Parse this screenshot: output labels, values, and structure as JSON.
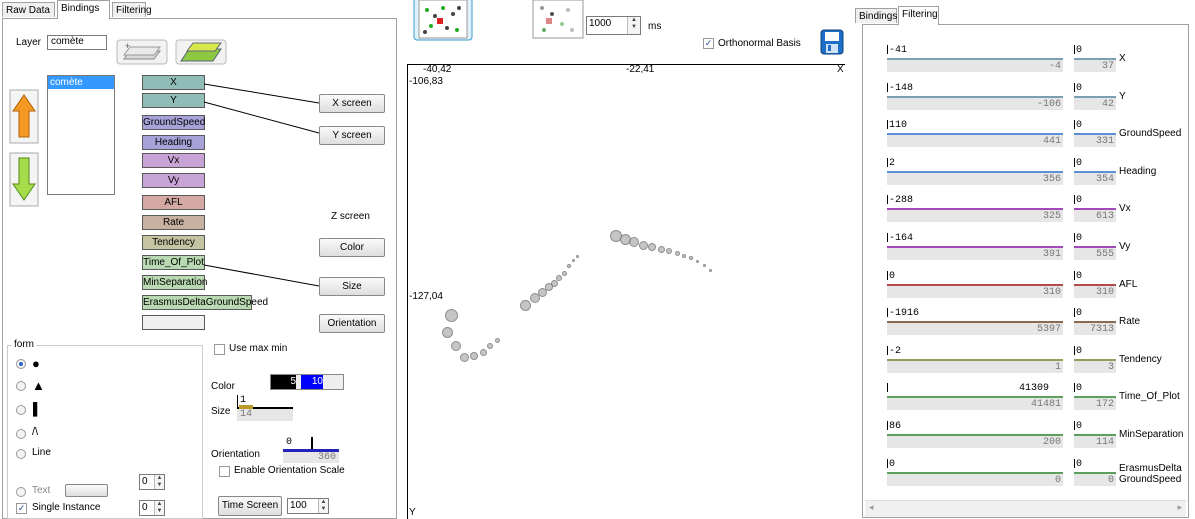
{
  "left_tabs": [
    "Raw Data",
    "Bindings",
    "Filtering"
  ],
  "layer": {
    "label": "Layer",
    "value": "comète",
    "list_items": [
      "comète"
    ]
  },
  "fields": [
    "X",
    "Y",
    "GroundSpeed",
    "Heading",
    "Vx",
    "Vy",
    "AFL",
    "Rate",
    "Tendency",
    "Time_Of_Plot",
    "MinSeparation",
    "ErasmusDeltaGroundSpeed",
    ""
  ],
  "field_colors": [
    "#8fbcb6",
    "#8fbcb6",
    "#a7a3d8",
    "#a7a3d8",
    "#c8a4d6",
    "#c8a4d6",
    "#d4a9a4",
    "#c8b1a0",
    "#c4c3a2",
    "#b9d9b2",
    "#b9d9b2",
    "#b9d9b2",
    "#f0f0f0"
  ],
  "screen_buttons": {
    "x": "X screen",
    "y": "Y screen",
    "z_label": "Z screen",
    "color": "Color",
    "size": "Size",
    "orientation": "Orientation"
  },
  "form": {
    "legend": "form",
    "options": [
      "●",
      "▲",
      "▌",
      "/\\",
      "Line"
    ],
    "text_label": "Text",
    "single_instance": "Single Instance",
    "text_spin": "0",
    "single_spin": "0"
  },
  "use_max_min": "Use max min",
  "color": {
    "label": "Color",
    "from": "5",
    "to": "10"
  },
  "size": {
    "label": "Size",
    "v1": "1",
    "v2": "14"
  },
  "orientation": {
    "label": "Orientation",
    "v1": "0",
    "v2": "360",
    "enable": "Enable Orientation Scale"
  },
  "time_screen": {
    "button": "Time Screen",
    "value": "100"
  },
  "viz": {
    "ms_value": "1000",
    "ms_label": "ms",
    "orthonormal": "Orthonormal Basis",
    "x_left": "-40,42",
    "x_mid": "-22,41",
    "x_axis": "X",
    "y_top": "-106,83",
    "y_mid": "-127,04",
    "y_axis": "Y"
  },
  "right_tabs": [
    "Bindings",
    "Filtering"
  ],
  "filters": [
    {
      "name": "X",
      "a1": "-41",
      "a2": "-4",
      "b1": "0",
      "b2": "37",
      "color": "#7a9fb2"
    },
    {
      "name": "Y",
      "a1": "-148",
      "a2": "-106",
      "b1": "0",
      "b2": "42",
      "color": "#7a9fb2"
    },
    {
      "name": "GroundSpeed",
      "a1": "110",
      "a2": "441",
      "b1": "0",
      "b2": "331",
      "color": "#5b8fd6"
    },
    {
      "name": "Heading",
      "a1": "2",
      "a2": "356",
      "b1": "0",
      "b2": "354",
      "color": "#5b8fd6"
    },
    {
      "name": "Vx",
      "a1": "-288",
      "a2": "325",
      "b1": "0",
      "b2": "613",
      "color": "#a24bb8"
    },
    {
      "name": "Vy",
      "a1": "-164",
      "a2": "391",
      "b1": "0",
      "b2": "555",
      "color": "#a24bb8"
    },
    {
      "name": "AFL",
      "a1": "0",
      "a2": "310",
      "b1": "0",
      "b2": "310",
      "color": "#b24a4a"
    },
    {
      "name": "Rate",
      "a1": "-1916",
      "a2": "5397",
      "b1": "0",
      "b2": "7313",
      "color": "#8c6a4f"
    },
    {
      "name": "Tendency",
      "a1": "-2",
      "a2": "1",
      "b1": "0",
      "b2": "3",
      "color": "#9a9a5a"
    },
    {
      "name": "Time_Of_Plot",
      "a1": "41309",
      "a2": "41481",
      "b1": "0",
      "b2": "172",
      "color": "#5da05d"
    },
    {
      "name": "MinSeparation",
      "a1": "86",
      "a2": "200",
      "b1": "0",
      "b2": "114",
      "color": "#5da05d"
    },
    {
      "name": "ErasmusDeltaGroundSpeed",
      "a1": "0",
      "a2": "0",
      "b1": "0",
      "b2": "0",
      "color": "#5da05d"
    }
  ]
}
